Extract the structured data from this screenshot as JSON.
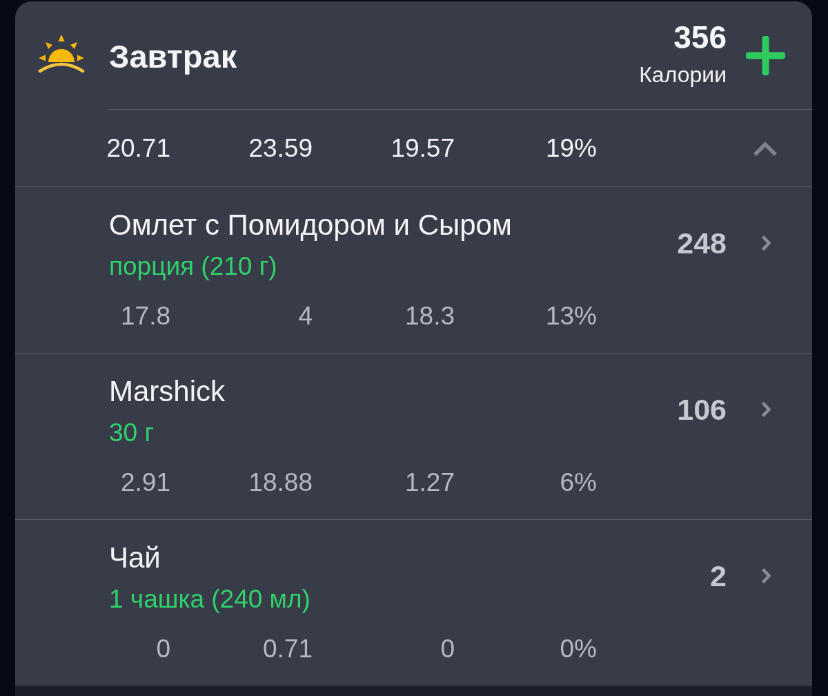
{
  "meal": {
    "title": "Завтрак",
    "calories": "356",
    "calories_label": "Калории",
    "expanded": true
  },
  "totals": [
    "20.71",
    "23.59",
    "19.57",
    "19%"
  ],
  "items": [
    {
      "name": "Омлет с Помидором и Сыром",
      "serving": "порция (210 г)",
      "calories": "248",
      "macros": [
        "17.8",
        "4",
        "18.3",
        "13%"
      ]
    },
    {
      "name": "Marshick",
      "serving": "30 г",
      "calories": "106",
      "macros": [
        "2.91",
        "18.88",
        "1.27",
        "6%"
      ]
    },
    {
      "name": "Чай",
      "serving": "1 чашка (240 мл)",
      "calories": "2",
      "macros": [
        "0",
        "0.71",
        "0",
        "0%"
      ]
    }
  ]
}
